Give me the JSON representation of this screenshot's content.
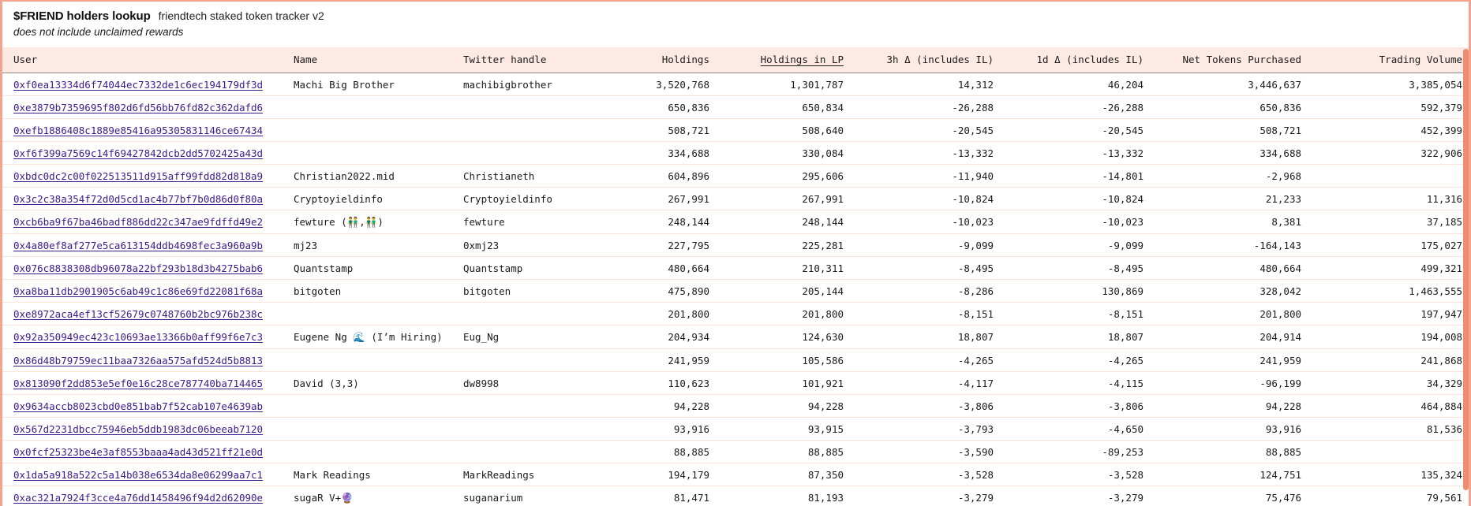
{
  "header": {
    "title": "$FRIEND holders lookup",
    "subtitle_inline": "friendtech staked token tracker v2",
    "note": "does not include unclaimed rewards"
  },
  "table": {
    "sorted_column": "Holdings in LP",
    "columns": [
      {
        "key": "user",
        "label": "User",
        "align": "left",
        "sorted": false
      },
      {
        "key": "name",
        "label": "Name",
        "align": "left",
        "sorted": false
      },
      {
        "key": "twitter",
        "label": "Twitter handle",
        "align": "left",
        "sorted": false
      },
      {
        "key": "hold",
        "label": "Holdings",
        "align": "right",
        "sorted": false
      },
      {
        "key": "lp",
        "label": "Holdings in LP",
        "align": "right",
        "sorted": true
      },
      {
        "key": "d3h",
        "label": "3h Δ (includes IL)",
        "align": "right",
        "sorted": false
      },
      {
        "key": "d1d",
        "label": "1d Δ (includes IL)",
        "align": "right",
        "sorted": false
      },
      {
        "key": "net",
        "label": "Net Tokens Purchased",
        "align": "right",
        "sorted": false
      },
      {
        "key": "vol",
        "label": "Trading Volume",
        "align": "right",
        "sorted": false
      }
    ],
    "rows": [
      {
        "user": "0xf0ea13334d6f74044ec7332de1c6ec194179df3d",
        "name": "Machi Big Brother",
        "twitter": "machibigbrother",
        "hold": "3,520,768",
        "lp": "1,301,787",
        "d3h": "14,312",
        "d3h_sign": "pos",
        "d1d": "46,204",
        "d1d_sign": "pos",
        "net": "3,446,637",
        "net_sign": "pos",
        "vol": "3,385,054",
        "vol_sign": "neutral"
      },
      {
        "user": "0xe3879b7359695f802d6fd56bb76fd82c362dafd6",
        "name": "",
        "twitter": "",
        "hold": "650,836",
        "lp": "650,834",
        "d3h": "-26,288",
        "d3h_sign": "neg",
        "d1d": "-26,288",
        "d1d_sign": "neg",
        "net": "650,836",
        "net_sign": "pos",
        "vol": "592,379",
        "vol_sign": "neutral"
      },
      {
        "user": "0xefb1886408c1889e85416a95305831146ce67434",
        "name": "",
        "twitter": "",
        "hold": "508,721",
        "lp": "508,640",
        "d3h": "-20,545",
        "d3h_sign": "neg",
        "d1d": "-20,545",
        "d1d_sign": "neg",
        "net": "508,721",
        "net_sign": "pos",
        "vol": "452,399",
        "vol_sign": "neutral"
      },
      {
        "user": "0xf6f399a7569c14f69427842dcb2dd5702425a43d",
        "name": "",
        "twitter": "",
        "hold": "334,688",
        "lp": "330,084",
        "d3h": "-13,332",
        "d3h_sign": "neg",
        "d1d": "-13,332",
        "d1d_sign": "neg",
        "net": "334,688",
        "net_sign": "pos",
        "vol": "322,906",
        "vol_sign": "neutral"
      },
      {
        "user": "0xbdc0dc2c00f022513511d915aff99fdd82d818a9",
        "name": "Christian2022.mid",
        "twitter": "Christianeth",
        "hold": "604,896",
        "lp": "295,606",
        "d3h": "-11,940",
        "d3h_sign": "neg",
        "d1d": "-14,801",
        "d1d_sign": "neg",
        "net": "-2,968",
        "net_sign": "neg",
        "vol": "",
        "vol_sign": "neutral"
      },
      {
        "user": "0x3c2c38a354f72d0d5cd1ac4b77bf7b0d86d0f80a",
        "name": "Cryptoyieldinfo",
        "twitter": "Cryptoyieldinfo",
        "hold": "267,991",
        "lp": "267,991",
        "d3h": "-10,824",
        "d3h_sign": "neg",
        "d1d": "-10,824",
        "d1d_sign": "neg",
        "net": "21,233",
        "net_sign": "pos",
        "vol": "11,316",
        "vol_sign": "neutral"
      },
      {
        "user": "0xcb6ba9f67ba46badf886dd22c347ae9fdffd49e2",
        "name": "fewture (👬,👬)",
        "twitter": "fewture",
        "hold": "248,144",
        "lp": "248,144",
        "d3h": "-10,023",
        "d3h_sign": "neg",
        "d1d": "-10,023",
        "d1d_sign": "neg",
        "net": "8,381",
        "net_sign": "pos",
        "vol": "37,185",
        "vol_sign": "neutral"
      },
      {
        "user": "0x4a80ef8af277e5ca613154ddb4698fec3a960a9b",
        "name": "mj23",
        "twitter": "0xmj23",
        "hold": "227,795",
        "lp": "225,281",
        "d3h": "-9,099",
        "d3h_sign": "neg",
        "d1d": "-9,099",
        "d1d_sign": "neg",
        "net": "-164,143",
        "net_sign": "neg",
        "vol": "175,027",
        "vol_sign": "neutral"
      },
      {
        "user": "0x076c8838308db96078a22bf293b18d3b4275bab6",
        "name": "Quantstamp",
        "twitter": "Quantstamp",
        "hold": "480,664",
        "lp": "210,311",
        "d3h": "-8,495",
        "d3h_sign": "neg",
        "d1d": "-8,495",
        "d1d_sign": "neg",
        "net": "480,664",
        "net_sign": "pos",
        "vol": "499,321",
        "vol_sign": "neutral"
      },
      {
        "user": "0xa8ba11db2901905c6ab49c1c86e69fd22081f68a",
        "name": "bitgoten",
        "twitter": "bitgoten",
        "hold": "475,890",
        "lp": "205,144",
        "d3h": "-8,286",
        "d3h_sign": "neg",
        "d1d": "130,869",
        "d1d_sign": "pos",
        "net": "328,042",
        "net_sign": "pos",
        "vol": "1,463,555",
        "vol_sign": "neutral"
      },
      {
        "user": "0xe8972aca4ef13cf52679c0748760b2bc976b238c",
        "name": "",
        "twitter": "",
        "hold": "201,800",
        "lp": "201,800",
        "d3h": "-8,151",
        "d3h_sign": "neg",
        "d1d": "-8,151",
        "d1d_sign": "neg",
        "net": "201,800",
        "net_sign": "pos",
        "vol": "197,947",
        "vol_sign": "neutral"
      },
      {
        "user": "0x92a350949ec423c10693ae13366b0aff99f6e7c3",
        "name": "Eugene Ng 🌊 (I’m Hiring)",
        "twitter": "Eug_Ng",
        "hold": "204,934",
        "lp": "124,630",
        "d3h": "18,807",
        "d3h_sign": "pos",
        "d1d": "18,807",
        "d1d_sign": "pos",
        "net": "204,914",
        "net_sign": "pos",
        "vol": "194,008",
        "vol_sign": "neutral"
      },
      {
        "user": "0x86d48b79759ec11baa7326aa575afd524d5b8813",
        "name": "",
        "twitter": "",
        "hold": "241,959",
        "lp": "105,586",
        "d3h": "-4,265",
        "d3h_sign": "neg",
        "d1d": "-4,265",
        "d1d_sign": "neg",
        "net": "241,959",
        "net_sign": "pos",
        "vol": "241,868",
        "vol_sign": "neutral"
      },
      {
        "user": "0x813090f2dd853e5ef0e16c28ce787740ba714465",
        "name": "David (3,3)",
        "twitter": "dw8998",
        "hold": "110,623",
        "lp": "101,921",
        "d3h": "-4,117",
        "d3h_sign": "neg",
        "d1d": "-4,115",
        "d1d_sign": "neg",
        "net": "-96,199",
        "net_sign": "neg",
        "vol": "34,329",
        "vol_sign": "neutral"
      },
      {
        "user": "0x9634accb8023cbd0e851bab7f52cab107e4639ab",
        "name": "",
        "twitter": "",
        "hold": "94,228",
        "lp": "94,228",
        "d3h": "-3,806",
        "d3h_sign": "neg",
        "d1d": "-3,806",
        "d1d_sign": "neg",
        "net": "94,228",
        "net_sign": "pos",
        "vol": "464,884",
        "vol_sign": "neutral"
      },
      {
        "user": "0x567d2231dbcc75946eb5ddb1983dc06beeab7120",
        "name": "",
        "twitter": "",
        "hold": "93,916",
        "lp": "93,915",
        "d3h": "-3,793",
        "d3h_sign": "neg",
        "d1d": "-4,650",
        "d1d_sign": "neg",
        "net": "93,916",
        "net_sign": "pos",
        "vol": "81,536",
        "vol_sign": "neutral"
      },
      {
        "user": "0x0fcf25323be4e3af8553baaa4ad43d521ff21e0d",
        "name": "",
        "twitter": "",
        "hold": "88,885",
        "lp": "88,885",
        "d3h": "-3,590",
        "d3h_sign": "neg",
        "d1d": "-89,253",
        "d1d_sign": "neg",
        "net": "88,885",
        "net_sign": "pos",
        "vol": "",
        "vol_sign": "neutral"
      },
      {
        "user": "0x1da5a918a522c5a14b038e6534da8e06299aa7c1",
        "name": "Mark Readings",
        "twitter": "MarkReadings",
        "hold": "194,179",
        "lp": "87,350",
        "d3h": "-3,528",
        "d3h_sign": "neg",
        "d1d": "-3,528",
        "d1d_sign": "neg",
        "net": "124,751",
        "net_sign": "pos",
        "vol": "135,324",
        "vol_sign": "neutral"
      },
      {
        "user": "0xac321a7924f3cce4a76dd1458496f94d2d62090e",
        "name": "sugaR V+🔮",
        "twitter": "suganarium",
        "hold": "81,471",
        "lp": "81,193",
        "d3h": "-3,279",
        "d3h_sign": "neg",
        "d1d": "-3,279",
        "d1d_sign": "neg",
        "net": "75,476",
        "net_sign": "pos",
        "vol": "79,561",
        "vol_sign": "neutral"
      }
    ]
  },
  "colors": {
    "positive": "#16a34a",
    "negative": "#ef4444",
    "link": "#3b1a8c",
    "header_bg": "#fdeae4",
    "frame": "#f4a48e"
  }
}
